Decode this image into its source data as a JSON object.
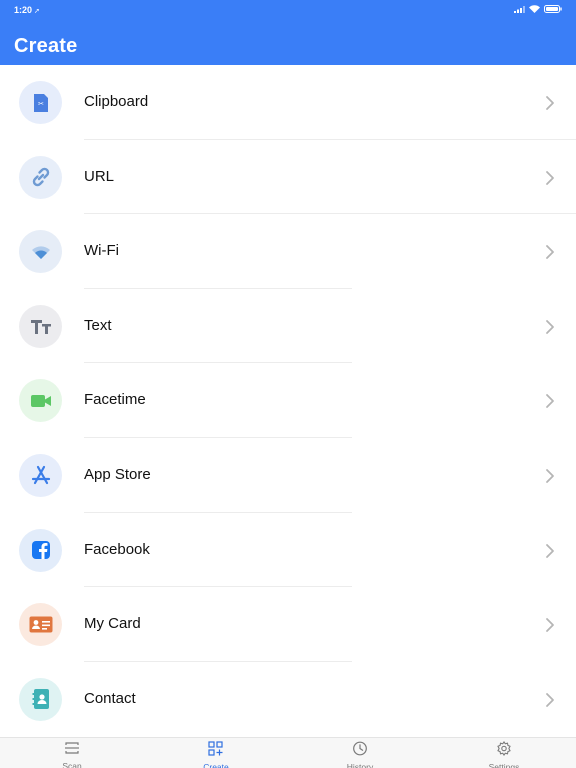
{
  "status_bar": {
    "time": "1:20"
  },
  "header": {
    "title": "Create"
  },
  "items": [
    {
      "label": "Clipboard",
      "icon": "clipboard-icon",
      "bg": "#e6edfb",
      "color": "#4a7fe0"
    },
    {
      "label": "URL",
      "icon": "link-icon",
      "bg": "#e7eef9",
      "color": "#6f9bd3"
    },
    {
      "label": "Wi-Fi",
      "icon": "wifi-icon",
      "bg": "#e6edf7",
      "color": "#4d8fd6"
    },
    {
      "label": "Text",
      "icon": "text-icon",
      "bg": "#ececef",
      "color": "#6b7280"
    },
    {
      "label": "Facetime",
      "icon": "video-camera-icon",
      "bg": "#e6f7e7",
      "color": "#5cc765"
    },
    {
      "label": "App Store",
      "icon": "app-store-icon",
      "bg": "#e6edfb",
      "color": "#3b7de8"
    },
    {
      "label": "Facebook",
      "icon": "facebook-icon",
      "bg": "#e2ecfa",
      "color": "#1877f2"
    },
    {
      "label": "My Card",
      "icon": "id-card-icon",
      "bg": "#fbe9df",
      "color": "#e0763f"
    },
    {
      "label": "Contact",
      "icon": "contact-book-icon",
      "bg": "#dff3f3",
      "color": "#3eb1b5"
    }
  ],
  "tabs": [
    {
      "label": "Scan",
      "icon": "scan-icon",
      "active": false
    },
    {
      "label": "Create",
      "icon": "create-qr-icon",
      "active": true
    },
    {
      "label": "History",
      "icon": "history-icon",
      "active": false
    },
    {
      "label": "Settings",
      "icon": "settings-gear-icon",
      "active": false
    }
  ],
  "colors": {
    "accent": "#3a7ef7",
    "active_tab": "#2f6fe0"
  }
}
